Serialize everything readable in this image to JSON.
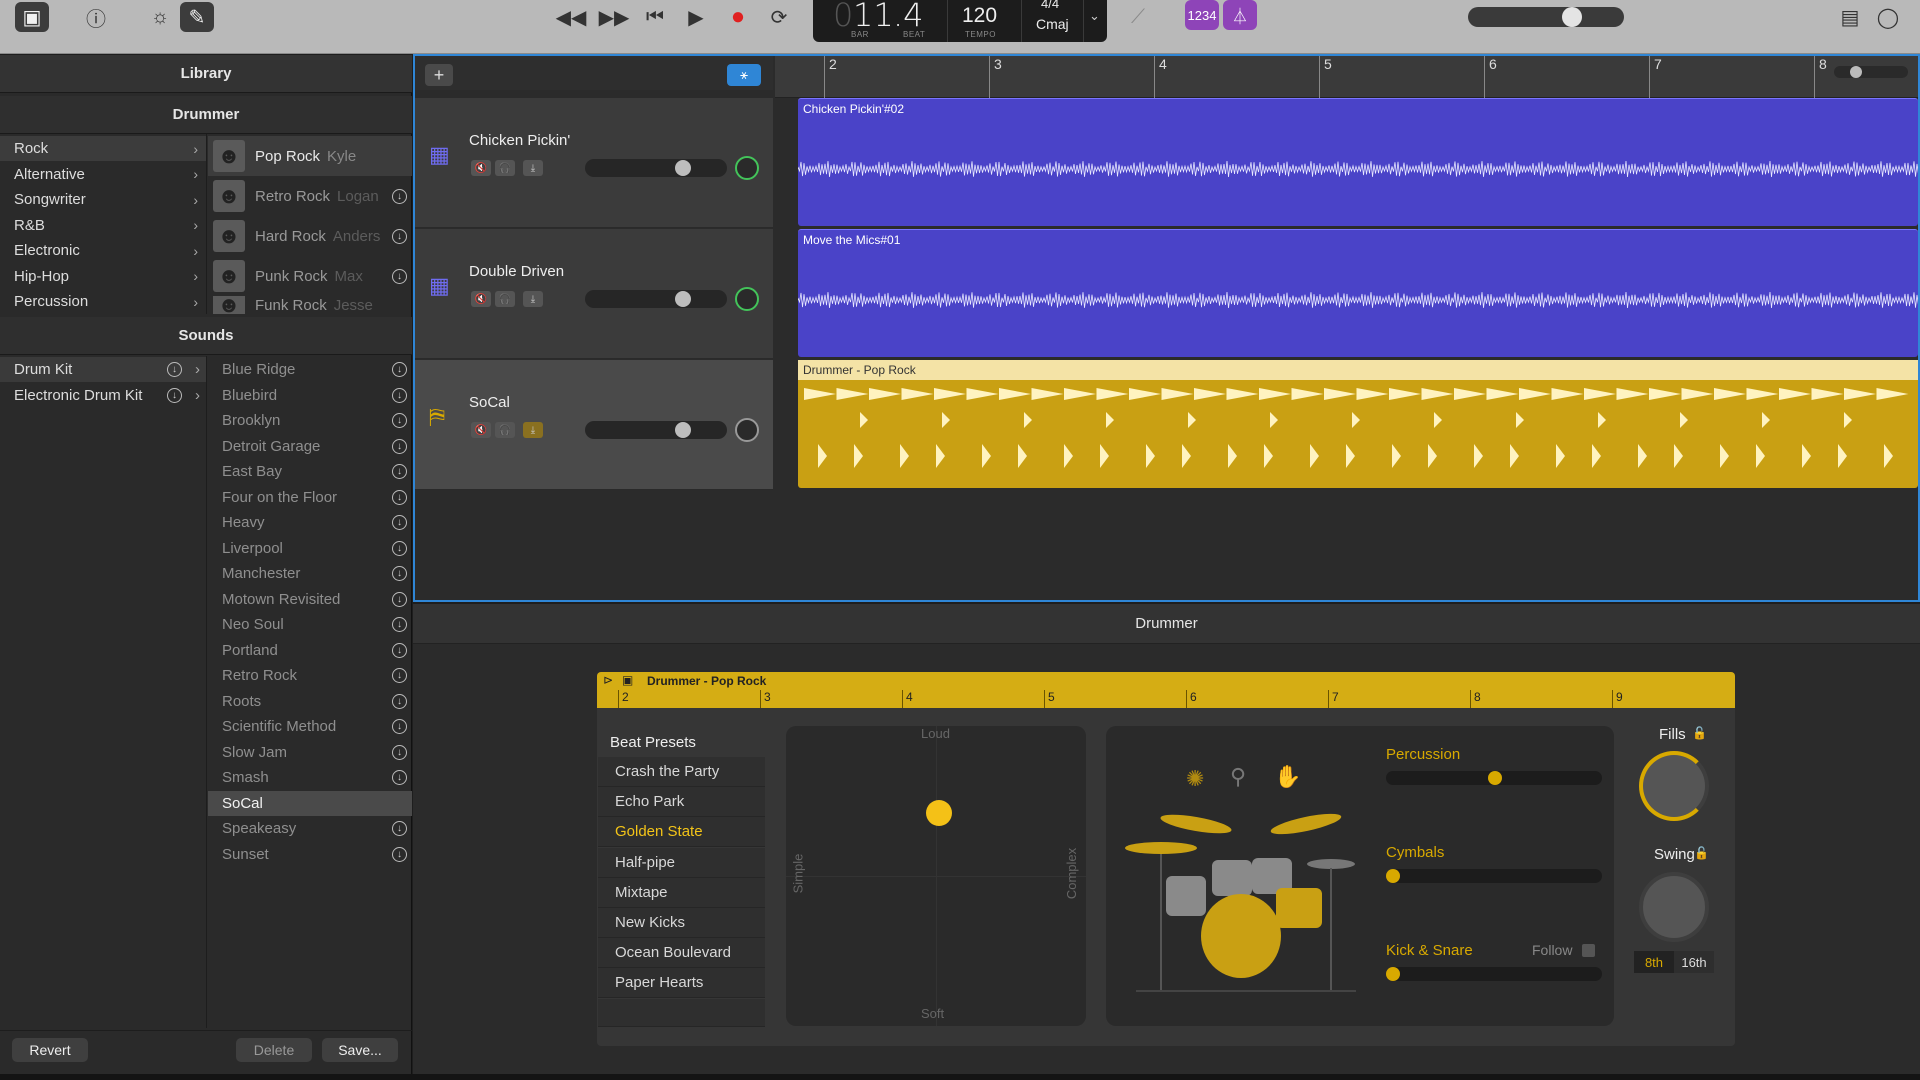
{
  "toolbar": {
    "lcd_bar": "11",
    "lcd_bar_prefix": "0",
    "lcd_beat": ".4",
    "lcd_bar_label": "BAR",
    "lcd_beat_label": "BEAT",
    "tempo": "120",
    "tempo_label": "TEMPO",
    "time_signature": "4/4",
    "key": "Cmaj",
    "count_in_label": "1234"
  },
  "library": {
    "title": "Library",
    "drummer_section": "Drummer",
    "genres": [
      "Rock",
      "Alternative",
      "Songwriter",
      "R&B",
      "Electronic",
      "Hip-Hop",
      "Percussion"
    ],
    "drummers": [
      {
        "name": "Pop Rock",
        "who": "Kyle"
      },
      {
        "name": "Retro Rock",
        "who": "Logan"
      },
      {
        "name": "Hard Rock",
        "who": "Anders"
      },
      {
        "name": "Punk Rock",
        "who": "Max"
      },
      {
        "name": "Funk Rock",
        "who": "Jesse"
      }
    ],
    "sounds_section": "Sounds",
    "kits": [
      "Drum Kit",
      "Electronic Drum Kit"
    ],
    "sounds": [
      "Blue Ridge",
      "Bluebird",
      "Brooklyn",
      "Detroit Garage",
      "East Bay",
      "Four on the Floor",
      "Heavy",
      "Liverpool",
      "Manchester",
      "Motown Revisited",
      "Neo Soul",
      "Portland",
      "Retro Rock",
      "Roots",
      "Scientific Method",
      "Slow Jam",
      "Smash",
      "SoCal",
      "Speakeasy",
      "Sunset"
    ],
    "selected_sound": "SoCal",
    "revert": "Revert",
    "delete": "Delete",
    "save": "Save..."
  },
  "tracks": {
    "add": "+",
    "ruler": [
      "2",
      "3",
      "4",
      "5",
      "6",
      "7",
      "8"
    ],
    "items": [
      {
        "name": "Chicken Pickin'",
        "region": "Chicken Pickin'#02"
      },
      {
        "name": "Double Driven",
        "region": "Move the Mics#01"
      },
      {
        "name": "SoCal",
        "region": "Drummer - Pop Rock"
      }
    ]
  },
  "editor": {
    "title": "Drummer",
    "region_name": "Drummer - Pop Rock",
    "ruler": [
      "2",
      "3",
      "4",
      "5",
      "6",
      "7",
      "8",
      "9"
    ],
    "beat_presets_title": "Beat Presets",
    "presets": [
      "Crash the Party",
      "Echo Park",
      "Golden State",
      "Half-pipe",
      "Mixtape",
      "New Kicks",
      "Ocean Boulevard",
      "Paper Hearts"
    ],
    "selected_preset": "Golden State",
    "xy": {
      "top": "Loud",
      "bottom": "Soft",
      "left": "Simple",
      "right": "Complex"
    },
    "percussion": "Percussion",
    "cymbals": "Cymbals",
    "kick_snare": "Kick & Snare",
    "follow": "Follow",
    "fills": "Fills",
    "swing": "Swing",
    "note_8th": "8th",
    "note_16th": "16th"
  },
  "colors": {
    "accent": "#d8a900",
    "selection": "#2f86d6",
    "region_blue": "#4a43c8",
    "region_gold": "#c9a013",
    "purple": "#8e44b8"
  }
}
